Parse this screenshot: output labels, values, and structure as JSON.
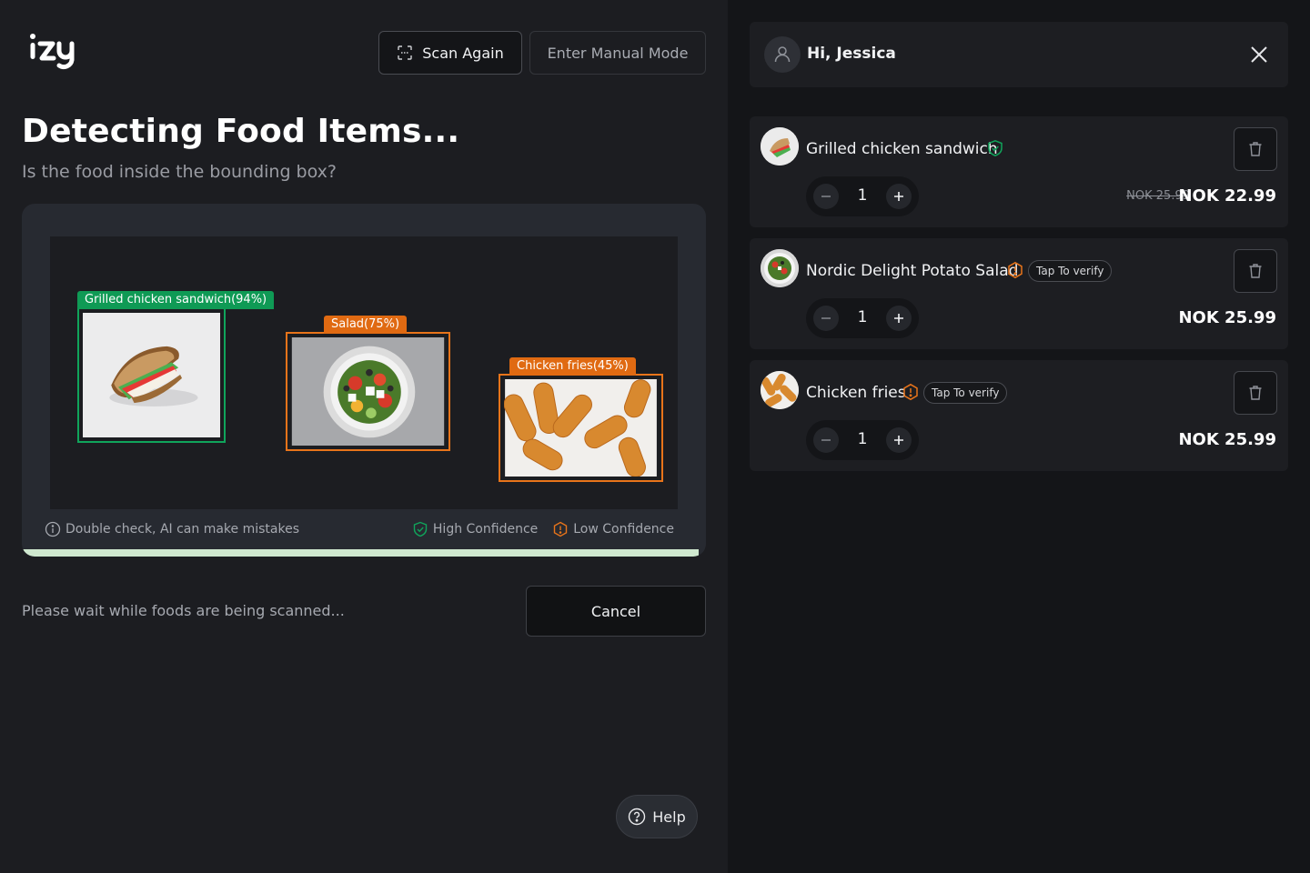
{
  "header": {
    "logo_text": "izy",
    "scan_again_label": "Scan Again",
    "manual_mode_label": "Enter Manual Mode"
  },
  "main": {
    "title": "Detecting Food Items...",
    "subtitle": "Is the food inside the bounding box?",
    "detections": [
      {
        "label": "Grilled chicken sandwich(94%)",
        "confidence": "high",
        "color": "#10a45b"
      },
      {
        "label": "Salad(75%)",
        "confidence": "low",
        "color": "#e8741a"
      },
      {
        "label": "Chicken fries(45%)",
        "confidence": "low",
        "color": "#e8741a"
      }
    ],
    "disclaimer": "Double check, AI can make mistakes",
    "legend_high": "High Confidence",
    "legend_low": "Low Confidence",
    "progress": 0.99,
    "wait_text": "Please wait while foods are being scanned...",
    "cancel_label": "Cancel",
    "help_label": "Help"
  },
  "sidebar": {
    "greeting": "Hi, Jessica",
    "items": [
      {
        "name": "Grilled chicken sandwich",
        "status": "verified",
        "quantity": "1",
        "old_price": "NOK 25.99",
        "price": "NOK 22.99",
        "verify_label": ""
      },
      {
        "name": "Nordic Delight Potato Salad",
        "status": "unverified",
        "quantity": "1",
        "old_price": "",
        "price": "NOK 25.99",
        "verify_label": "Tap To verify"
      },
      {
        "name": "Chicken fries",
        "status": "unverified",
        "quantity": "1",
        "old_price": "",
        "price": "NOK 25.99",
        "verify_label": "Tap To verify"
      }
    ]
  },
  "colors": {
    "high_confidence": "#10a45b",
    "low_confidence": "#e8741a",
    "progress": "#cfe8cf"
  }
}
